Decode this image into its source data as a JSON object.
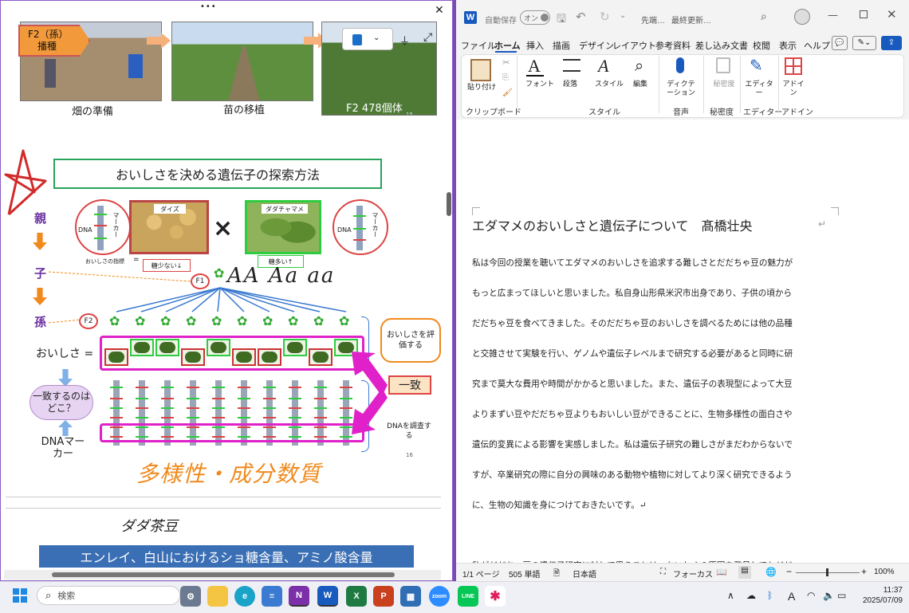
{
  "left": {
    "top_dots": "•••",
    "close": "✕",
    "toolbar_icons": [
      "notebook-icon",
      "chevron-down-icon",
      "filter-icon",
      "expand-icon"
    ],
    "top_photos": {
      "f2_label": "F2（孫）",
      "f2_sub": "播種",
      "cap1": "畑の準備",
      "cap2": "苗の移植",
      "cap3": "F2 478個体",
      "cap3_num": "15"
    },
    "slide": {
      "title": "おいしさを決める遺伝子の探索方法",
      "gen_parent": "親",
      "gen_child": "子",
      "gen_grandchild": "孫",
      "dna": "DNA",
      "marker": "マーカー",
      "daizu": "ダイズ",
      "dadacha": "ダダチャマメ",
      "index_label": "おいしさの指標",
      "eq": "=",
      "low_sugar": "糖少ない↓",
      "high_sugar": "糖多い↑",
      "cross": "×",
      "f1": "F1",
      "f2": "F2",
      "handwriting_genotypes": "AA Aa aa",
      "oishisa": "おいしさ =",
      "eval_box": "おいしさを評価する",
      "match": "一致",
      "where_match": "一致するのはどこ？",
      "dna_marker": "DNAマーカー",
      "dna_survey": "DNAを調査する",
      "page_num": "16",
      "handwriting_orange": "多様性・成分数質"
    },
    "bottom": {
      "handwriting": "ダダ茶豆",
      "banner": "エンレイ、白山におけるショ糖含量、アミノ酸含量"
    }
  },
  "word": {
    "title_bar": {
      "autosave": "自動保存",
      "autosave_state": "オン",
      "doc_name": "先端…",
      "last_saved": "最終更新…"
    },
    "menu": [
      "ファイル",
      "ホーム",
      "挿入",
      "描画",
      "デザイン",
      "レイアウト",
      "参考資料",
      "差し込み文書",
      "校閲",
      "表示",
      "ヘルプ"
    ],
    "ribbon": {
      "paste": "貼り付け",
      "clipboard": "クリップボード",
      "font": "フォント",
      "paragraph": "段落",
      "style": "スタイル",
      "style_group": "スタイル",
      "edit": "編集",
      "dictation": "ディクテーション",
      "voice": "音声",
      "sensitivity": "秘密度",
      "sensitivity_group": "秘密度",
      "editor": "エディター",
      "editor_group": "エディター",
      "addin": "アドイン",
      "addin_group": "アドイン"
    },
    "doc": {
      "title": "エダマメのおいしさと遺伝子について　髙橋壮央",
      "lines": [
        "私は今回の授業を聴いてエダマメのおいしさを追求する難しさとだだちゃ豆の魅力が",
        "もっと広まってほしいと思いました。私自身山形県米沢市出身であり、子供の頃から",
        "だだちゃ豆を食べてきました。そのだだちゃ豆のおいしさを調べるためには他の品種",
        "と交雑させて実験を行い、ゲノムや遺伝子レベルまで研究する必要があると同時に研",
        "究まで莫大な費用や時間がかかると思いました。また、遺伝子の表現型によって大豆",
        "よりまずい豆やだだちゃ豆よりもおいしい豆ができることに、生物多様性の面白さや",
        "遺伝的変異による影響を実感しました。私は遺伝子研究の難しさがまだわからないで",
        "すが、卒業研究の際に自分の興味のある動物や植物に対してより深く研究できるよう",
        "に、生物の知識を身につけておきたいです。↵",
        "",
        "私がだだちゃ豆の遺伝子研究に対して思うことは、おいしさの原因を発見してもだだ"
      ]
    },
    "status": {
      "page": "1/1 ページ",
      "words": "505 単語",
      "lang": "日本語",
      "focus": "フォーカス",
      "zoom": "100%"
    }
  },
  "taskbar": {
    "search": "検索",
    "time": "11:37",
    "date": "2025/07/09",
    "ime": "A"
  },
  "colors": {
    "accent": "#7a4bb5",
    "word_blue": "#185abd",
    "orange": "#f08a1c",
    "magenta": "#e020c8",
    "green": "#2ecc40",
    "red": "#cc3333"
  }
}
